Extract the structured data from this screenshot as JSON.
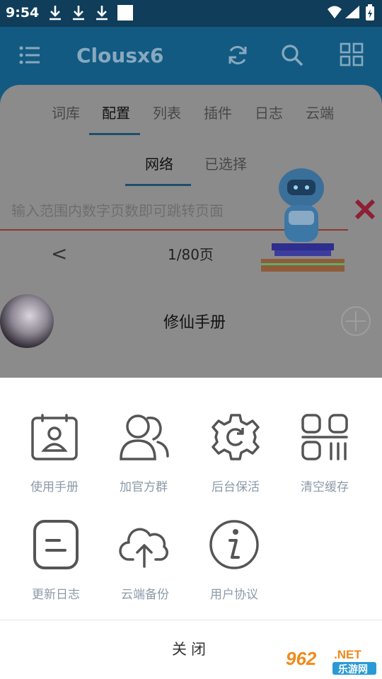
{
  "status_bar": {
    "time": "9:54",
    "icons": [
      "download-icon",
      "download-icon",
      "download-icon",
      "notification-square",
      "wifi-icon",
      "signal-icon",
      "battery-icon"
    ]
  },
  "app_bar": {
    "title": "Clousx6",
    "icons": [
      "menu-icon",
      "refresh-icon",
      "search-icon",
      "grid-icon"
    ]
  },
  "tabs": [
    "词库",
    "配置",
    "列表",
    "插件",
    "日志",
    "云端"
  ],
  "active_tab": "配置",
  "sub_tabs": [
    "网络",
    "已选择"
  ],
  "active_sub_tab": "网络",
  "page_jump": {
    "placeholder": "输入范围内数字页数即可跳转页面"
  },
  "pager": {
    "prev_symbol": "<",
    "label": "1/80页"
  },
  "list_item": {
    "name": "修仙手册"
  },
  "sheet": {
    "items": [
      {
        "label": "使用手册",
        "icon": "manual-icon"
      },
      {
        "label": "加官方群",
        "icon": "group-icon"
      },
      {
        "label": "后台保活",
        "icon": "gear-icon"
      },
      {
        "label": "清空缓存",
        "icon": "clear-cache-icon"
      },
      {
        "label": "更新日志",
        "icon": "log-icon"
      },
      {
        "label": "云端备份",
        "icon": "cloud-upload-icon"
      },
      {
        "label": "用户协议",
        "icon": "info-icon"
      }
    ],
    "close_label": "关闭"
  },
  "watermark": {
    "number": "962",
    "domain": ".NET",
    "brand": "乐游网"
  },
  "colors": {
    "app_bar": "#135a82",
    "status_bar": "#0f3d5a",
    "dim_overlay": "#8b8b8b",
    "sheet_label": "#8c9aa8",
    "icon_stroke": "#555555",
    "accent_red": "#8e1f34"
  }
}
